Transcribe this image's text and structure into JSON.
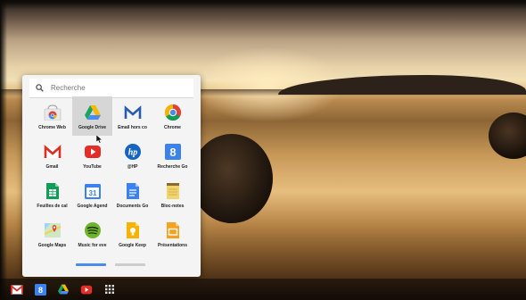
{
  "search": {
    "placeholder": "Recherche"
  },
  "apps": [
    {
      "label": "Chrome Web",
      "icon": "chrome-web-store-icon"
    },
    {
      "label": "Google Drive",
      "icon": "google-drive-icon"
    },
    {
      "label": "Email hors co",
      "icon": "gmail-offline-icon"
    },
    {
      "label": "Chrome",
      "icon": "chrome-icon"
    },
    {
      "label": "Gmail",
      "icon": "gmail-icon"
    },
    {
      "label": "YouTube",
      "icon": "youtube-icon"
    },
    {
      "label": "@HP",
      "icon": "hp-icon"
    },
    {
      "label": "Recherche Go",
      "icon": "google-search-icon"
    },
    {
      "label": "Feuilles de cal",
      "icon": "sheets-icon"
    },
    {
      "label": "Google Agend",
      "icon": "calendar-icon"
    },
    {
      "label": "Documents Go",
      "icon": "docs-icon"
    },
    {
      "label": "Bloc-notes",
      "icon": "notepad-icon"
    },
    {
      "label": "Google Maps",
      "icon": "maps-icon"
    },
    {
      "label": "Music for eve",
      "icon": "spotify-icon"
    },
    {
      "label": "Google Keep",
      "icon": "keep-icon"
    },
    {
      "label": "Présentations",
      "icon": "slides-icon"
    }
  ],
  "calendar_day": "31",
  "hp_text": "hp",
  "search_g": "8",
  "selected_app_index": 1,
  "pages": {
    "count": 2,
    "current": 1
  },
  "shelf": [
    {
      "icon": "gmail-shelf-icon"
    },
    {
      "icon": "google-search-shelf-icon",
      "text": "8"
    },
    {
      "icon": "google-drive-shelf-icon"
    },
    {
      "icon": "youtube-shelf-icon"
    },
    {
      "icon": "app-launcher-icon"
    }
  ],
  "colors": {
    "accent_blue": "#4a8bf0",
    "gmail_red": "#d93025",
    "youtube_red": "#e52d27",
    "drive_yellow": "#f6b800",
    "drive_green": "#1da462",
    "sheets_green": "#0f9d58",
    "keep_yellow": "#f6b400",
    "slides_orange": "#f4a21e"
  }
}
